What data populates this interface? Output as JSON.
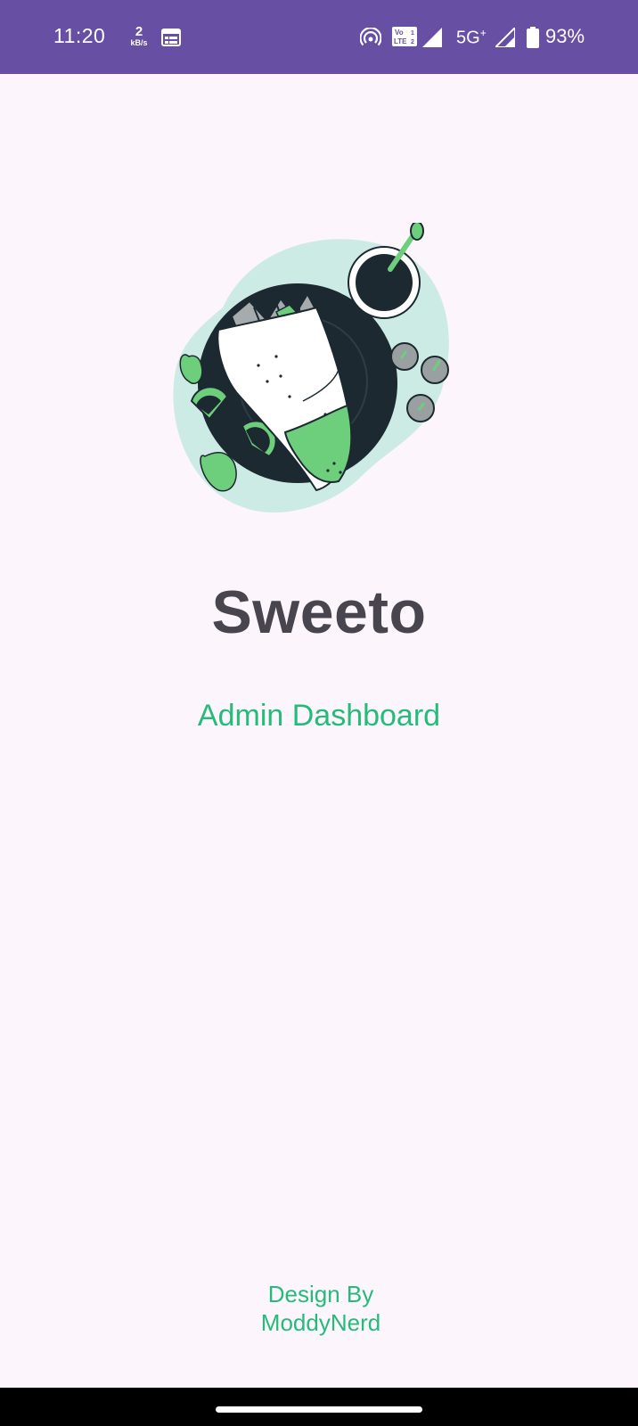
{
  "status_bar": {
    "time": "11:20",
    "speed_value": "2",
    "speed_unit": "kB/s",
    "network": "5G",
    "network_sup": "+",
    "battery": "93%",
    "icons": [
      "calendar-icon",
      "hotspot-icon",
      "volte-icon",
      "signal-icon",
      "signal-icon",
      "battery-icon"
    ]
  },
  "splash": {
    "title": "Sweeto",
    "subtitle": "Admin Dashboard",
    "credit_line1": "Design By",
    "credit_line2": "ModdyNerd"
  },
  "colors": {
    "status_bar": "#6750A4",
    "background": "#FCF5FC",
    "accent": "#25BB7A",
    "title": "#48454E"
  }
}
